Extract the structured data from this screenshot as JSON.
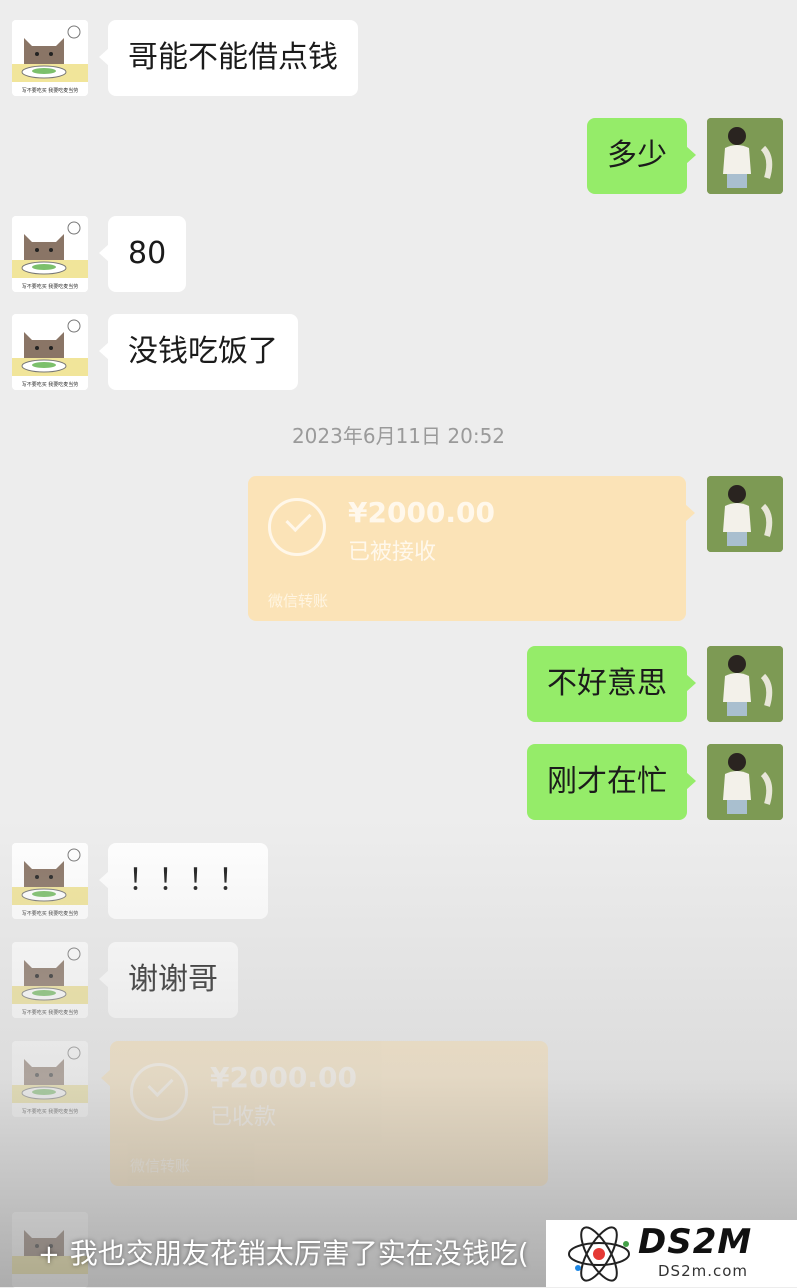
{
  "messages": {
    "m1": {
      "text": "哥能不能借点钱"
    },
    "m2": {
      "text": "多少"
    },
    "m3": {
      "text": "80"
    },
    "m4": {
      "text": "没钱吃饭了"
    },
    "timestamp": "2023年6月11日 20:52",
    "transfer1": {
      "amount": "¥2000.00",
      "status": "已被接收",
      "footer": "微信转账"
    },
    "m5": {
      "text": "不好意思"
    },
    "m6": {
      "text": "刚才在忙"
    },
    "m7": {
      "text": "！！！！"
    },
    "m8": {
      "text": "谢谢哥"
    },
    "transfer2": {
      "amount": "¥2000.00",
      "status": "已收款",
      "footer": "微信转账"
    }
  },
  "avatar_caption": "写不要吃买 我要吃麦当劳",
  "overlay": {
    "plus": "+",
    "caption": "我也交朋友花销太厉害了实在没钱吃("
  },
  "watermark": {
    "logo": "DS2M",
    "sub": "DS2m.com"
  },
  "colors": {
    "bg": "#ededed",
    "out_bubble": "#95ec69",
    "in_bubble": "#ffffff",
    "transfer": "#fbe3b7"
  }
}
